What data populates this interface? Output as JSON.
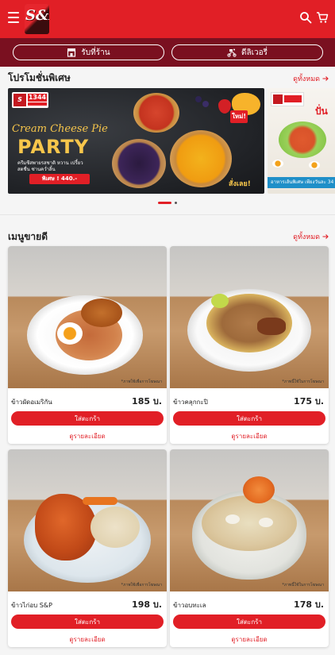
{
  "header": {
    "logo_text": "S&P",
    "icons": {
      "menu": "hamburger-icon",
      "search": "search-icon",
      "cart": "cart-icon"
    },
    "brand_color": "#e11f26"
  },
  "subbar": {
    "pickup_label": "รับที่ร้าน",
    "delivery_label": "ดีลิเวอรี่",
    "background": "#7a1020"
  },
  "promotions": {
    "title": "โปรโมชั่นพิเศษ",
    "see_all": "ดูทั้งหมด",
    "banners": [
      {
        "hotline": "1344",
        "headline": "Cream Cheese Pie",
        "subheadline": "PARTY",
        "tagline": "ครีมชีสพายรสชาติ หวาน เปรี้ยว สดชื่น ซ่านคว่ำลิ้น",
        "price_text": "พิเศษ ! 440.-",
        "badge": "ใหม่!",
        "cta": "สั่งเลย!"
      },
      {
        "hotline": "1344",
        "headline": "ปั่น",
        "strip_text": "อาหารเส้นพิเศษ เพียงวันละ 34"
      }
    ],
    "active_index": 0
  },
  "bestsellers": {
    "title": "เมนูขายดี",
    "see_all": "ดูทั้งหมด",
    "add_label": "ใส่ตะกร้า",
    "detail_label": "ดูรายละเอียด",
    "items": [
      {
        "name": "ข้าวผัดอเมริกัน",
        "price": "185 บ.",
        "caption": "*ภาพใช้เพื่อการโฆษณา"
      },
      {
        "name": "ข้าวคลุกกะปิ",
        "price": "175 บ.",
        "caption": "*ภาพนี้ใช้ในการโฆษณา"
      },
      {
        "name": "ข้าวไก่อบ S&P",
        "price": "198 บ.",
        "caption": "*ภาพใช้เพื่อการโฆษณา"
      },
      {
        "name": "ข้าวอบทะเล",
        "price": "178 บ.",
        "caption": "*ภาพนี้ใช้ในการโฆษณา"
      }
    ]
  }
}
